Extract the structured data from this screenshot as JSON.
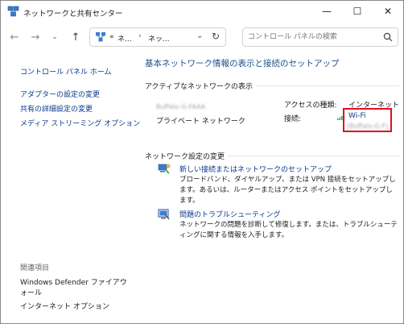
{
  "window": {
    "title": "ネットワークと共有センター",
    "controls": {
      "minimize": "—",
      "maximize": "☐",
      "close": "✕"
    }
  },
  "nav": {
    "back": "←",
    "forward": "→",
    "recent": "⌄",
    "up": "↑",
    "address": {
      "prefix": "«",
      "segment1": "ネ...",
      "separator": "›",
      "segment2": "ネッ...",
      "dropdown": "⌄",
      "refresh": "↻"
    },
    "search_placeholder": "コントロール パネルの検索"
  },
  "left": {
    "home": "コントロール パネル ホーム",
    "links": [
      "アダプターの設定の変更",
      "共有の詳細設定の変更",
      "メディア ストリーミング オプション"
    ],
    "related_title": "関連項目",
    "related": [
      "Windows Defender ファイアウォール",
      "インターネット オプション"
    ]
  },
  "main": {
    "title": "基本ネットワーク情報の表示と接続のセットアップ",
    "active_label": "アクティブなネットワークの表示",
    "network_name_blurred": "Buffalo-G-FAAA",
    "network_type": "プライベート ネットワーク",
    "access_type_label": "アクセスの種類:",
    "access_type_value": "インターネット",
    "connection_label": "接続:",
    "connection_value": "Wi-Fi",
    "connection_ssid_blurred": "(Buffalo-G-F)",
    "settings_label": "ネットワーク設定の変更",
    "tasks": [
      {
        "link": "新しい接続またはネットワークのセットアップ",
        "desc": "ブロードバンド、ダイヤルアップ、または VPN 接続をセットアップします。あるいは、ルーターまたはアクセス ポイントをセットアップします。"
      },
      {
        "link": "問題のトラブルシューティング",
        "desc": "ネットワークの問題を診断して修復します。または、トラブルシューティングに関する情報を入手します。"
      }
    ]
  },
  "colors": {
    "link": "#0a3a8a",
    "title_blue": "#1a4e8c",
    "highlight": "#e0101d"
  }
}
